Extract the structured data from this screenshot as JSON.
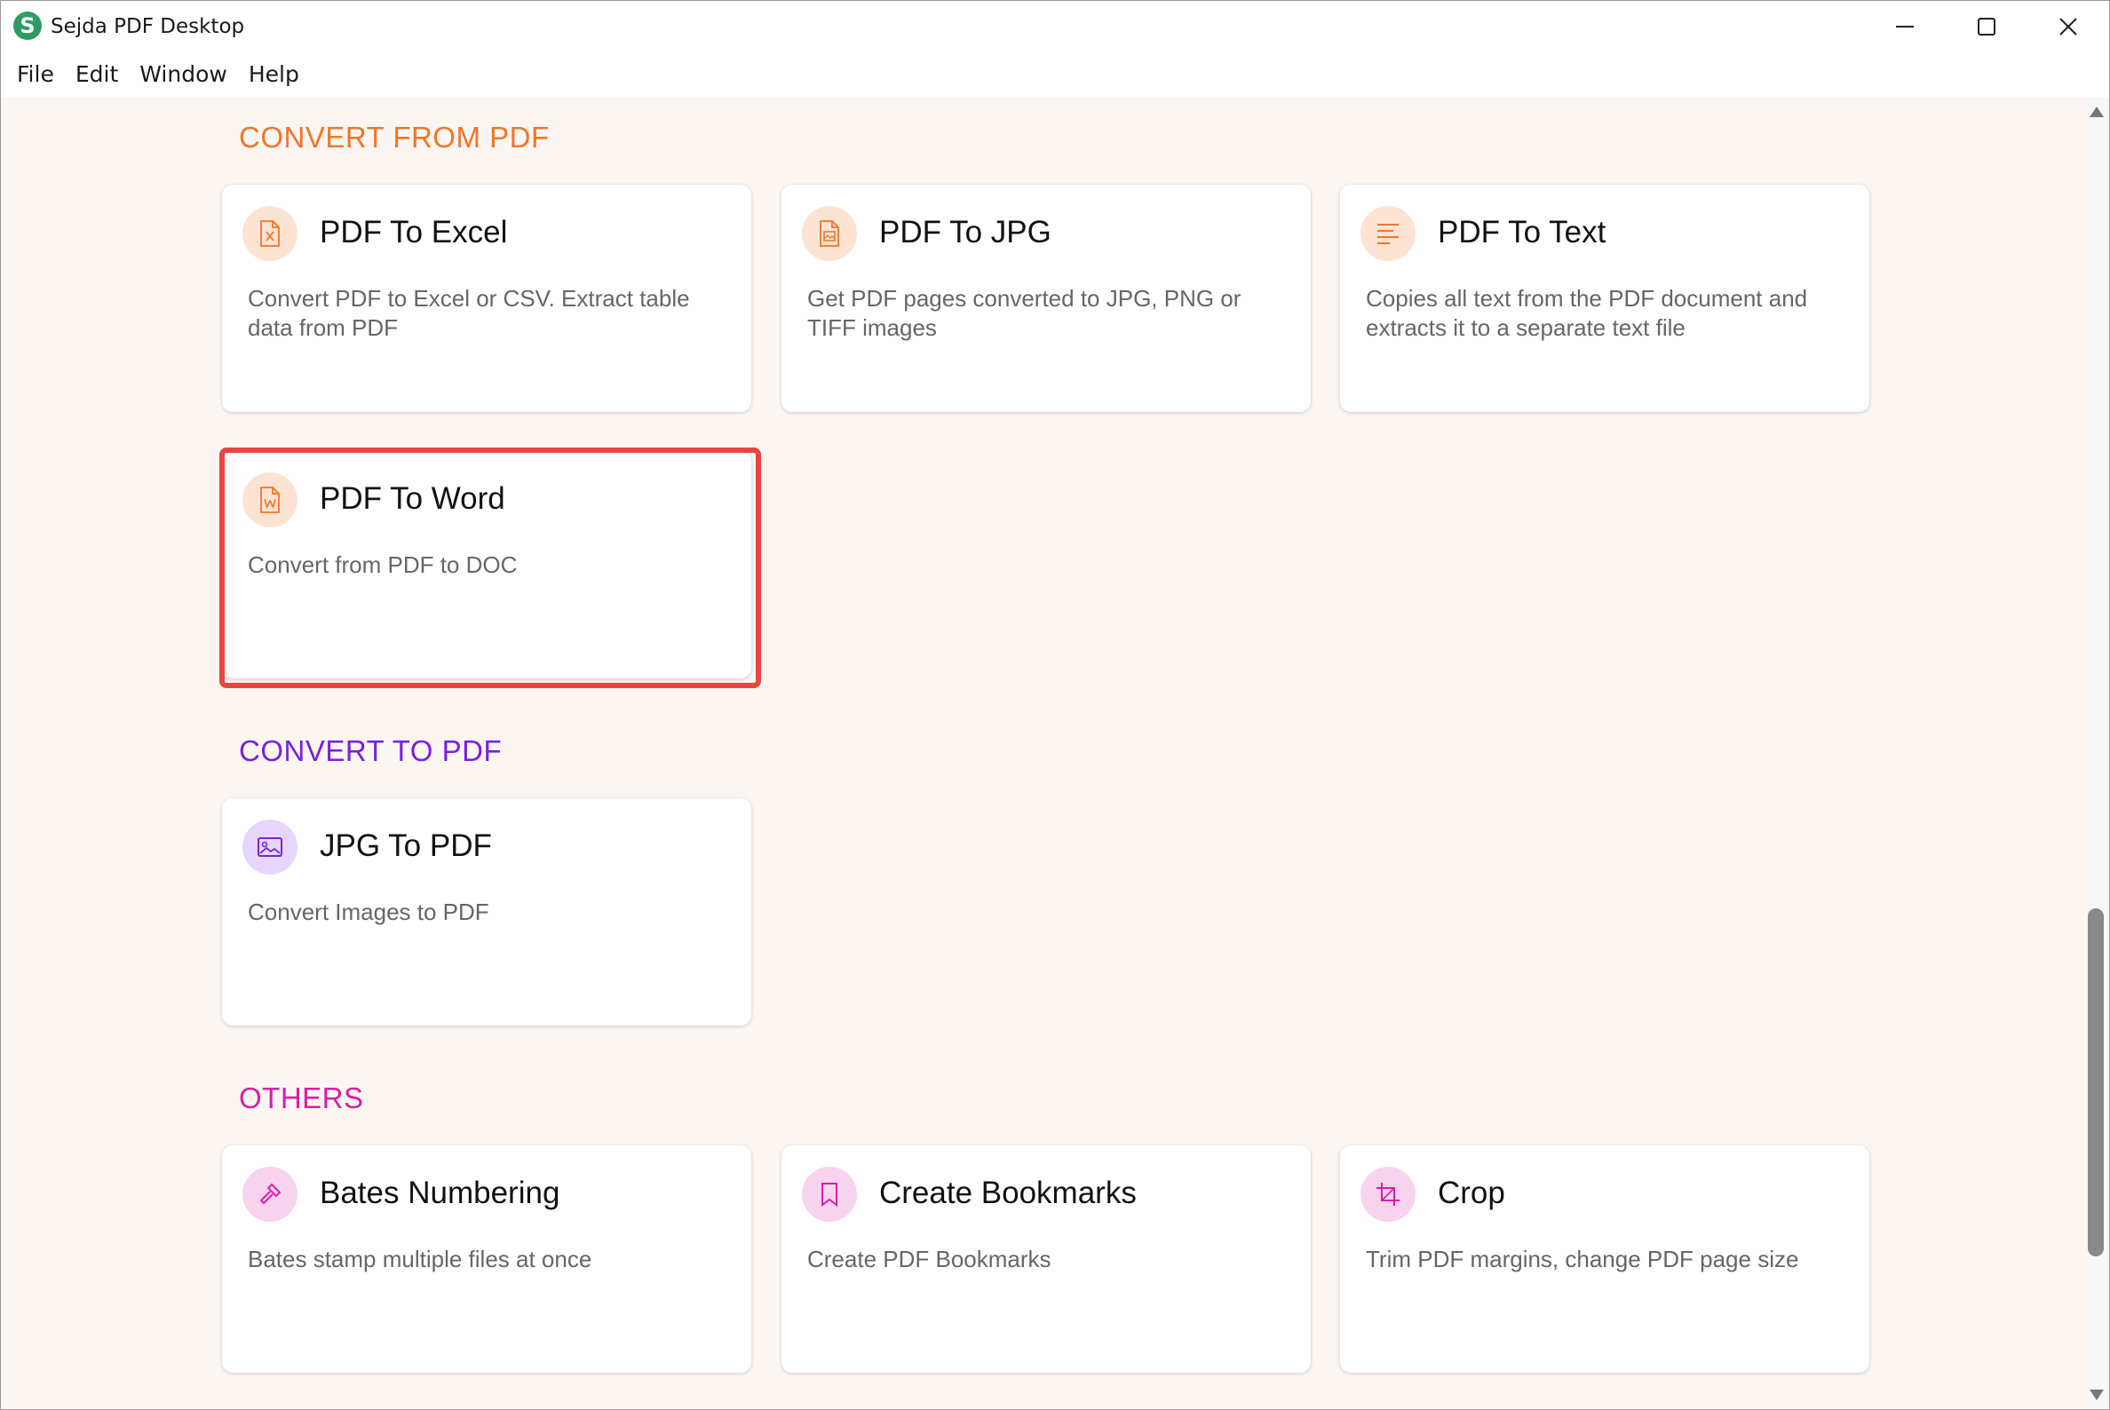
{
  "window": {
    "title": "Sejda PDF Desktop",
    "logo_letter": "S",
    "logo_color": "#2e9b63"
  },
  "menu": [
    "File",
    "Edit",
    "Window",
    "Help"
  ],
  "sections": {
    "convert_from": {
      "title": "CONVERT FROM PDF",
      "color": "#f0762a",
      "cards": [
        {
          "title": "PDF To Excel",
          "desc": "Convert PDF to Excel or CSV. Extract table data from PDF",
          "icon": "excel-file-icon"
        },
        {
          "title": "PDF To JPG",
          "desc": "Get PDF pages converted to JPG, PNG or TIFF images",
          "icon": "image-file-icon"
        },
        {
          "title": "PDF To Text",
          "desc": "Copies all text from the PDF document and extracts it to a separate text file",
          "icon": "text-lines-icon"
        },
        {
          "title": "PDF To Word",
          "desc": "Convert from PDF to DOC",
          "icon": "word-file-icon"
        }
      ]
    },
    "convert_to": {
      "title": "CONVERT TO PDF",
      "color": "#7a1fe0",
      "cards": [
        {
          "title": "JPG To PDF",
          "desc": "Convert Images to PDF",
          "icon": "image-icon"
        }
      ]
    },
    "others": {
      "title": "OTHERS",
      "color": "#d61fa8",
      "cards": [
        {
          "title": "Bates Numbering",
          "desc": "Bates stamp multiple files at once",
          "icon": "stamp-icon"
        },
        {
          "title": "Create Bookmarks",
          "desc": "Create PDF Bookmarks",
          "icon": "bookmark-icon"
        },
        {
          "title": "Crop",
          "desc": "Trim PDF margins, change PDF page size",
          "icon": "crop-icon"
        }
      ]
    }
  },
  "highlighted_card": "PDF To Word"
}
